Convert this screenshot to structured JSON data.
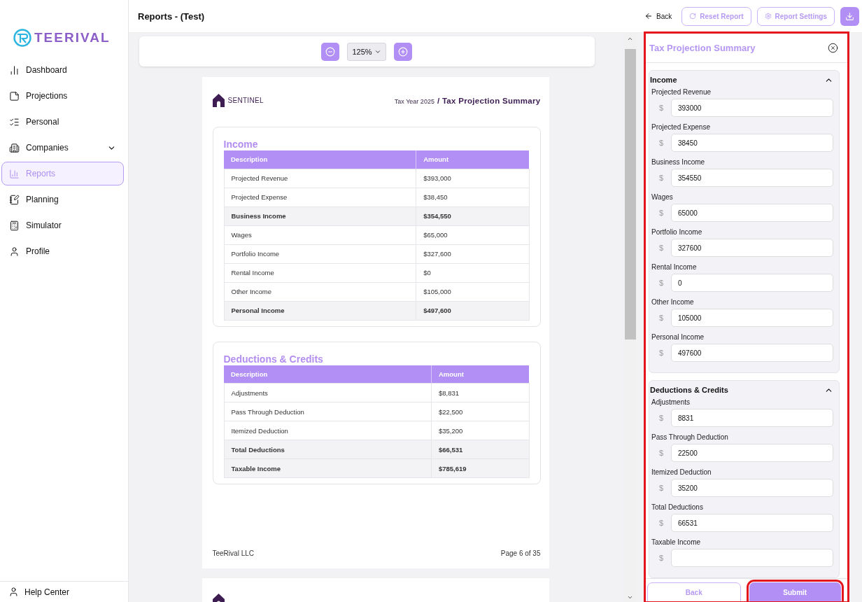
{
  "sidebar": {
    "logo": "TEERIVAL",
    "items": [
      {
        "label": "Dashboard",
        "selected": false,
        "expandable": false
      },
      {
        "label": "Projections",
        "selected": false,
        "expandable": false
      },
      {
        "label": "Personal",
        "selected": false,
        "expandable": false
      },
      {
        "label": "Companies",
        "selected": false,
        "expandable": true
      },
      {
        "label": "Reports",
        "selected": true,
        "expandable": false
      },
      {
        "label": "Planning",
        "selected": false,
        "expandable": false
      },
      {
        "label": "Simulator",
        "selected": false,
        "expandable": false
      },
      {
        "label": "Profile",
        "selected": false,
        "expandable": false
      }
    ],
    "footer": "Help Center"
  },
  "header": {
    "title": "Reports - (Test)",
    "back": "Back",
    "buttons": [
      "Reset Report",
      "Report Settings"
    ]
  },
  "viewer": {
    "zoom": "125%",
    "page": {
      "logo": "SENTINEL",
      "tax_year": "Tax Year 2025",
      "title": "/ Tax Projection Summary",
      "sections": [
        {
          "title": "Income",
          "columns": [
            "Description",
            "Amount"
          ],
          "rows": [
            {
              "description": "Projected Revenue",
              "amount": "$393,000",
              "total": false
            },
            {
              "description": "Projected Expense",
              "amount": "$38,450",
              "total": false
            },
            {
              "description": "Business Income",
              "amount": "$354,550",
              "total": true
            },
            {
              "description": "Wages",
              "amount": "$65,000",
              "total": false
            },
            {
              "description": "Portfolio Income",
              "amount": "$327,600",
              "total": false
            },
            {
              "description": "Rental Income",
              "amount": "$0",
              "total": false
            },
            {
              "description": "Other Income",
              "amount": "$105,000",
              "total": false
            },
            {
              "description": "Personal Income",
              "amount": "$497,600",
              "total": true
            }
          ]
        },
        {
          "title": "Deductions & Credits",
          "columns": [
            "Description",
            "Amount"
          ],
          "rows": [
            {
              "description": "Adjustments",
              "amount": "$8,831",
              "total": false
            },
            {
              "description": "Pass Through Deduction",
              "amount": "$22,500",
              "total": false
            },
            {
              "description": "Itemized Deduction",
              "amount": "$35,200",
              "total": false
            },
            {
              "description": "Total Deductions",
              "amount": "$66,531",
              "total": true
            },
            {
              "description": "Taxable Income",
              "amount": "$785,619",
              "total": true
            }
          ]
        }
      ],
      "footer_left": "TeeRival LLC",
      "footer_right": "Page 6 of 35"
    }
  },
  "panel": {
    "title": "Tax Projection Summary",
    "groups": [
      {
        "title": "Income",
        "expanded": true,
        "fields": [
          {
            "label": "Projected Revenue",
            "prefix": "$",
            "value": "393000"
          },
          {
            "label": "Projected Expense",
            "prefix": "$",
            "value": "38450"
          },
          {
            "label": "Business Income",
            "prefix": "$",
            "value": "354550"
          },
          {
            "label": "Wages",
            "prefix": "$",
            "value": "65000"
          },
          {
            "label": "Portfolio Income",
            "prefix": "$",
            "value": "327600"
          },
          {
            "label": "Rental Income",
            "prefix": "$",
            "value": "0"
          },
          {
            "label": "Other Income",
            "prefix": "$",
            "value": "105000"
          },
          {
            "label": "Personal Income",
            "prefix": "$",
            "value": "497600"
          }
        ]
      },
      {
        "title": "Deductions & Credits",
        "expanded": true,
        "fields": [
          {
            "label": "Adjustments",
            "prefix": "$",
            "value": "8831"
          },
          {
            "label": "Pass Through Deduction",
            "prefix": "$",
            "value": "22500"
          },
          {
            "label": "Itemized Deduction",
            "prefix": "$",
            "value": "35200"
          },
          {
            "label": "Total Deductions",
            "prefix": "$",
            "value": "66531"
          },
          {
            "label": "Taxable Income",
            "prefix": "$"
          }
        ]
      }
    ],
    "back": "Back",
    "submit": "Submit"
  }
}
